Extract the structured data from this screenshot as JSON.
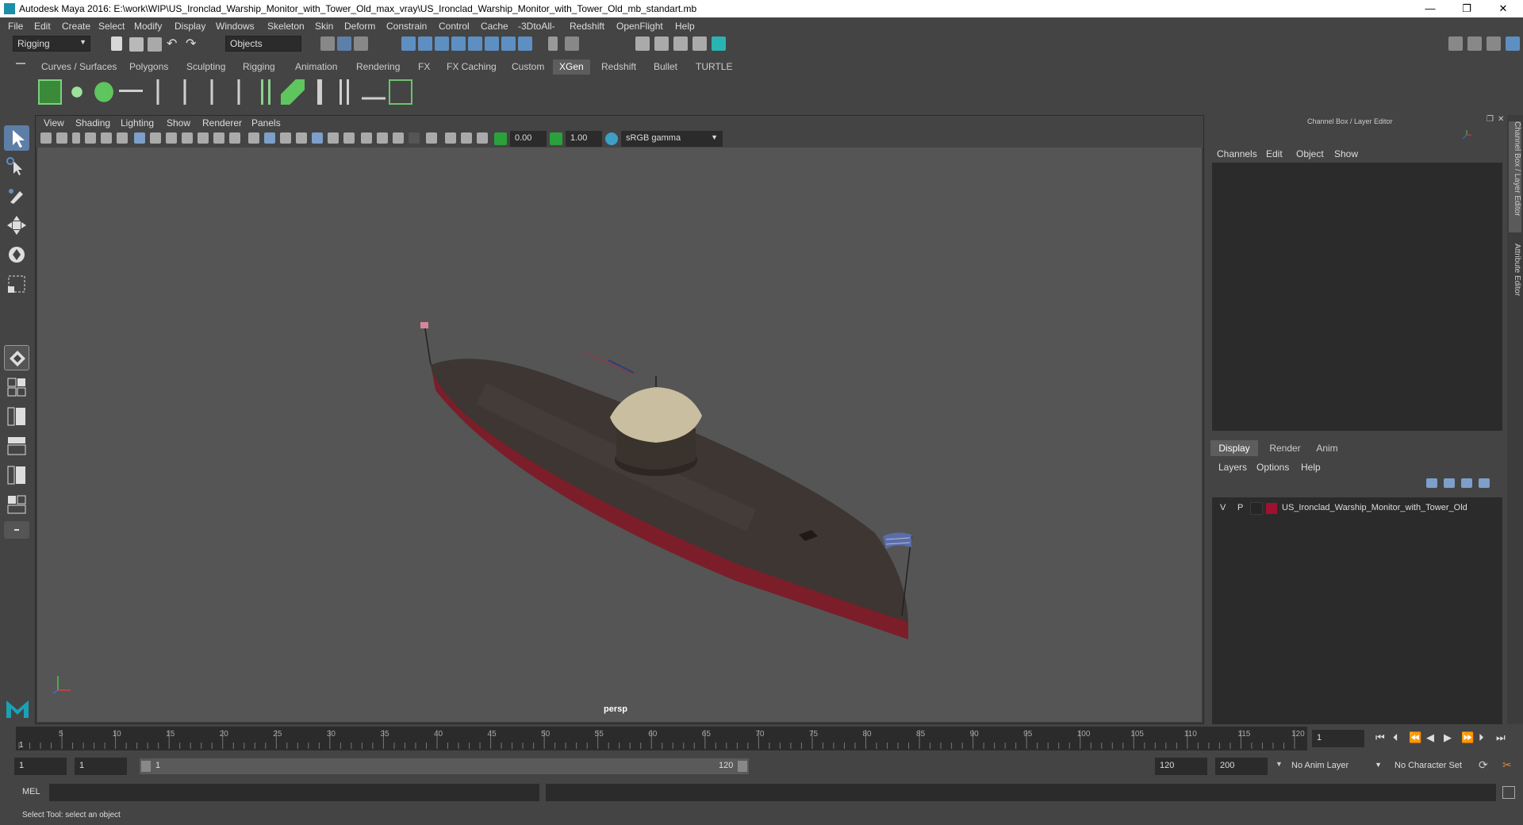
{
  "window": {
    "title": "Autodesk Maya 2016: E:\\work\\WIP\\US_Ironclad_Warship_Monitor_with_Tower_Old_max_vray\\US_Ironclad_Warship_Monitor_with_Tower_Old_mb_standart.mb",
    "minimize": "—",
    "restore": "❐",
    "close": "✕"
  },
  "menubar": [
    "File",
    "Edit",
    "Create",
    "Select",
    "Modify",
    "Display",
    "Windows",
    "Skeleton",
    "Skin",
    "Deform",
    "Constrain",
    "Control",
    "Cache",
    "-3DtoAll-",
    "Redshift",
    "OpenFlight",
    "Help"
  ],
  "statusline": {
    "mode": "Rigging",
    "selection_mask": "Objects"
  },
  "shelf_tabs": [
    "Curves / Surfaces",
    "Polygons",
    "Sculpting",
    "Rigging",
    "Animation",
    "Rendering",
    "FX",
    "FX Caching",
    "Custom",
    "XGen",
    "Redshift",
    "Bullet",
    "TURTLE"
  ],
  "shelf_active": "XGen",
  "viewport": {
    "menus": [
      "View",
      "Shading",
      "Lighting",
      "Show",
      "Renderer",
      "Panels"
    ],
    "exposure": "0.00",
    "gamma": "1.00",
    "color_space": "sRGB gamma",
    "camera_label": "persp"
  },
  "channel_box": {
    "header": "Channel Box / Layer Editor",
    "menus": [
      "Channels",
      "Edit",
      "Object",
      "Show"
    ]
  },
  "layer_editor": {
    "tabs": [
      "Display",
      "Render",
      "Anim"
    ],
    "active_tab": "Display",
    "menus": [
      "Layers",
      "Options",
      "Help"
    ],
    "layers": [
      {
        "visible": "V",
        "playback": "P",
        "color": "#a01030",
        "name": "US_Ironclad_Warship_Monitor_with_Tower_Old"
      }
    ]
  },
  "side_tabs": [
    "Channel Box / Layer Editor",
    "Attribute Editor"
  ],
  "timeline": {
    "ticks": [
      "5",
      "10",
      "15",
      "20",
      "25",
      "30",
      "35",
      "40",
      "45",
      "50",
      "55",
      "60",
      "65",
      "70",
      "75",
      "80",
      "85",
      "90",
      "95",
      "100",
      "105",
      "110",
      "115",
      "120"
    ],
    "current_frame_marker": "1",
    "current_frame": "1"
  },
  "range": {
    "start": "1",
    "playback_start": "1",
    "slider_start": "1",
    "slider_end": "120",
    "playback_end": "120",
    "end": "200",
    "anim_layer": "No Anim Layer",
    "character_set": "No Character Set"
  },
  "command_line": {
    "label": "MEL"
  },
  "help_line": "Select Tool: select an object"
}
